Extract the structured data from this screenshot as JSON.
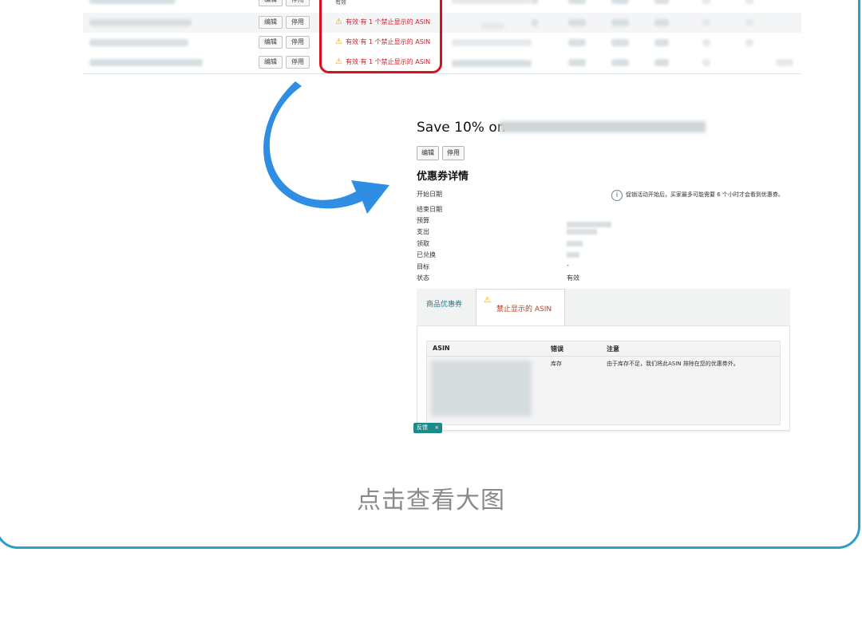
{
  "table": {
    "status_label": "有效",
    "edit_label": "编辑",
    "disable_label": "停用",
    "warning_text": "有效·有 1 个禁止显示的 ASIN"
  },
  "detail": {
    "title_prefix": "Save 10% on",
    "edit_button": "编辑",
    "disable_button": "停用",
    "section_title": "优惠券详情",
    "info_note": "促销活动开始后，买家最多可能需要 6 个小时才会看到优惠券。",
    "fields": {
      "start_date": "开始日期",
      "end_date": "结束日期",
      "budget": "预算",
      "spend": "支出",
      "claimed": "领取",
      "redeemed": "已兑换",
      "target": "目标",
      "status": "状态"
    },
    "target_value": "-",
    "status_value": "有效",
    "tabs": {
      "products": "商品优惠券",
      "suppressed": "禁止显示的 ASIN"
    },
    "table_headers": {
      "asin": "ASIN",
      "error": "错误",
      "note": "注意"
    },
    "row": {
      "error": "库存",
      "note": "由于库存不足，我们将此ASIN 排除在您的优惠券外。"
    },
    "feedback_label": "反馈",
    "feedback_close": "×"
  },
  "caption": "点击查看大图",
  "colors": {
    "frame_border": "#2aa0c6",
    "highlight_red": "#d8101f",
    "arrow_blue": "#2f8de4",
    "warning_text": "#d2212d"
  }
}
